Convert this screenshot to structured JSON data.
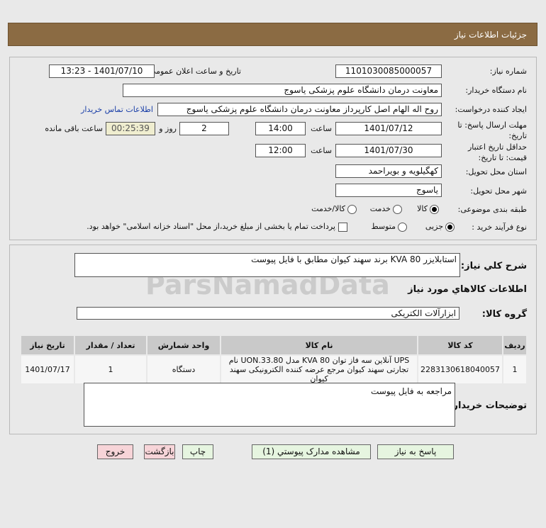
{
  "header": {
    "title": "جزئیات اطلاعات نیاز"
  },
  "form": {
    "need_number_label": "شماره نیاز:",
    "need_number": "1101030085000057",
    "announce_label": "تاریخ و ساعت اعلان عمومی:",
    "announce_value": "1401/07/10 - 13:23",
    "buyer_org_label": "نام دستگاه خریدار:",
    "buyer_org": "معاونت درمان دانشگاه علوم پزشکی یاسوج",
    "creator_label": "ایجاد کننده درخواست:",
    "creator": "روح اله الهام اصل کارپرداز معاونت درمان دانشگاه علوم پزشکی یاسوج",
    "contact_link": "اطلاعات تماس خریدار",
    "deadline_label": "مهلت ارسال پاسخ: تا تاریخ:",
    "deadline_date": "1401/07/12",
    "time_label": "ساعت",
    "deadline_time": "14:00",
    "days": "2",
    "days_label": "روز و",
    "remaining": "00:25:39",
    "remaining_label": "ساعت باقی مانده",
    "validity_label": "حداقل تاریخ اعتبار قیمت: تا تاریخ:",
    "validity_date": "1401/07/30",
    "validity_time": "12:00",
    "province_label": "استان محل تحویل:",
    "province": "کهگیلویه و بویراحمد",
    "city_label": "شهر محل تحویل:",
    "city": "یاسوج",
    "category_label": "طبقه بندی موضوعی:",
    "category_options": [
      "کالا",
      "خدمت",
      "کالا/خدمت"
    ],
    "category_selected": "کالا",
    "process_label": "نوع فرآیند خرید :",
    "process_options": [
      "جزیی",
      "متوسط"
    ],
    "process_selected": "جزیی",
    "payment_note": "پرداخت تمام یا بخشی از مبلغ خرید،از محل \"اسناد خزانه اسلامی\" خواهد بود."
  },
  "details": {
    "description_label": "شرح کلي نياز:",
    "description": "استابلایزر KVA 80 برند سهند کیوان مطابق با فایل پیوست",
    "goods_heading": "اطلاعات کالاهاي مورد نياز",
    "group_label": "گروه کالا:",
    "group": "ابزارآلات الکتریکی",
    "table": {
      "headers": [
        "ردیف",
        "کد کالا",
        "نام کالا",
        "واحد شمارش",
        "تعداد / مقدار",
        "تاریخ نیاز"
      ],
      "rows": [
        [
          "1",
          "2283130618040057",
          "UPS آنلاین سه فاز توان KVA 80 مدل UON.33.80 نام تجارتی سهند کیوان مرجع عرضه کننده الکترونیکی سهند کیوان",
          "دستگاه",
          "1",
          "1401/07/17"
        ]
      ]
    },
    "notes_label": "توضیحات خریدار:",
    "notes": "مراجعه به فایل پیوست"
  },
  "buttons": {
    "reply": "پاسخ به نیاز",
    "attachments": "مشاهده مدارک پیوستي (1)",
    "print": "چاپ",
    "back": "بازگشت",
    "exit": "خروج"
  },
  "watermark": {
    "brand": "ParsNamadData"
  }
}
